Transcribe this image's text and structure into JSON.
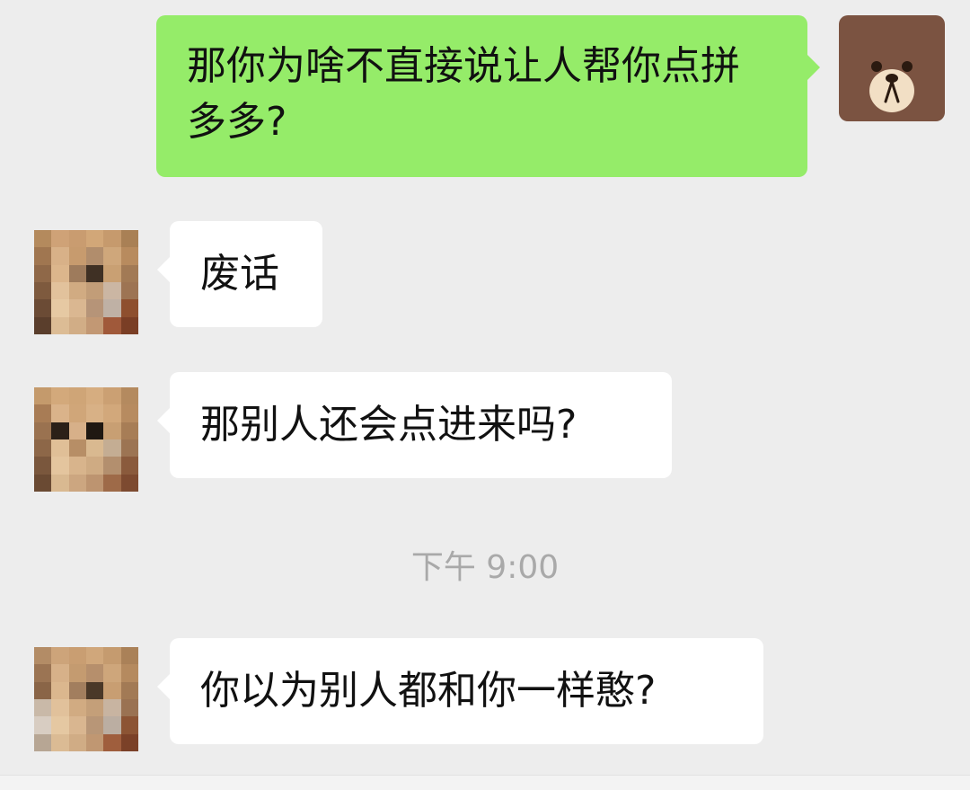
{
  "messages": [
    {
      "sender": "me",
      "text": "那你为啥不直接说让人帮你点拼多多?",
      "avatar_icon": "bear-icon"
    },
    {
      "sender": "other",
      "text": "废话",
      "avatar_icon": "pixelated-avatar"
    },
    {
      "sender": "other",
      "text": "那别人还会点进来吗?",
      "avatar_icon": "pixelated-avatar"
    },
    {
      "sender": "other",
      "text": "你以为别人都和你一样憨?",
      "avatar_icon": "pixelated-avatar"
    }
  ],
  "timestamp": "下午 9:00",
  "colors": {
    "background": "#ededed",
    "bubble_me": "#95ec69",
    "bubble_other": "#ffffff",
    "timestamp_text": "#a9a9a9",
    "bear_fur": "#7b5341"
  }
}
